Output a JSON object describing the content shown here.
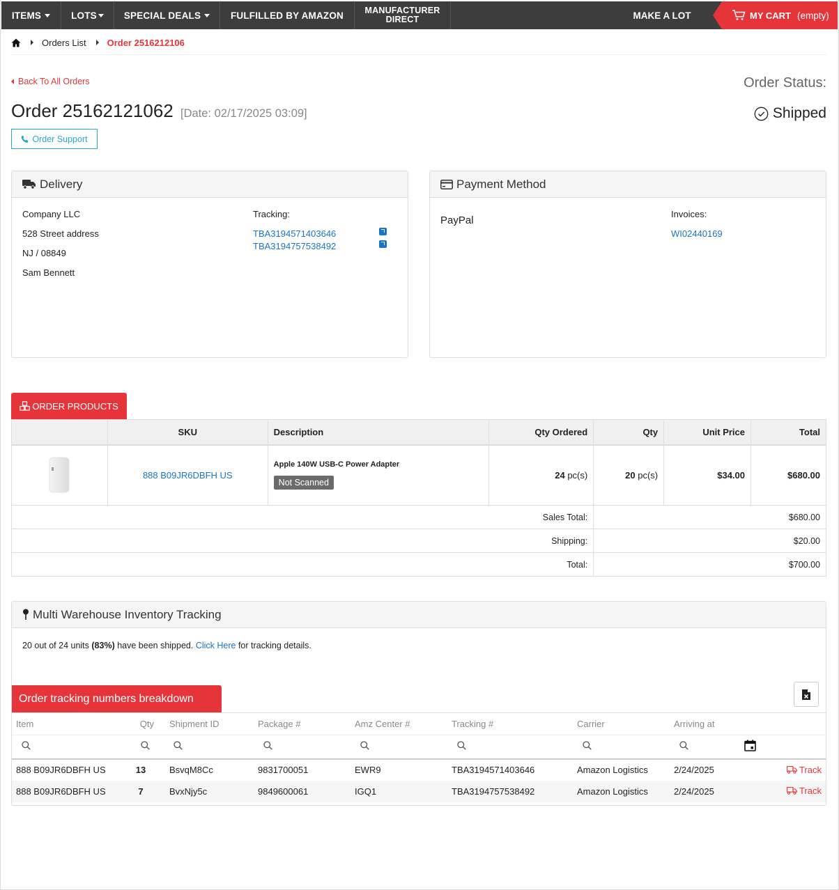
{
  "nav": {
    "items": [
      "ITEMS",
      "LOTS",
      "SPECIAL DEALS",
      "FULFILLED BY AMAZON"
    ],
    "manufacturer_line1": "MANUFACTURER",
    "manufacturer_line2": "DIRECT",
    "make_lot": "MAKE A LOT",
    "cart_label": "MY CART",
    "cart_status": "(empty)"
  },
  "breadcrumb": {
    "orders_list": "Orders List",
    "current": "Order 2516212106"
  },
  "order": {
    "back_link": "Back To All Orders",
    "title": "Order 25162121062",
    "date": "[Date: 02/17/2025 03:09]",
    "support_button": "Order Support",
    "status_label": "Order Status:",
    "status_value": "Shipped"
  },
  "delivery": {
    "title": "Delivery",
    "company": "Company LLC",
    "street": "528 Street address",
    "state_zip": "NJ / 08849",
    "contact": "Sam Bennett",
    "tracking_label": "Tracking:",
    "tracking": [
      "TBA3194571403646",
      "TBA3194757538492"
    ]
  },
  "payment": {
    "title": "Payment Method",
    "method": "PayPal",
    "invoices_label": "Invoices:",
    "invoice": "WI02440169"
  },
  "products": {
    "tab": "ORDER PRODUCTS",
    "headers": {
      "sku": "SKU",
      "description": "Description",
      "qty_ordered": "Qty Ordered",
      "qty": "Qty",
      "unit_price": "Unit Price",
      "total": "Total"
    },
    "rows": [
      {
        "sku": "888 B09JR6DBFH US",
        "description": "Apple 140W USB-C Power Adapter",
        "badge": "Not Scanned",
        "qty_ordered": "24",
        "qty": "20",
        "unit": "pc(s)",
        "unit_price": "$34.00",
        "total": "$680.00"
      }
    ],
    "summary": {
      "sales_total_label": "Sales Total:",
      "sales_total": "$680.00",
      "shipping_label": "Shipping:",
      "shipping": "$20.00",
      "total_label": "Total:",
      "total": "$700.00"
    }
  },
  "warehouse": {
    "title": "Multi Warehouse Inventory Tracking",
    "text_before": "20 out of 24 units ",
    "percent": "(83%)",
    "text_mid": " have been shipped. ",
    "link": "Click Here",
    "text_after": " for tracking details.",
    "breakdown_tab": "Order tracking numbers breakdown",
    "headers": {
      "item": "Item",
      "qty": "Qty",
      "shipment": "Shipment ID",
      "package": "Package #",
      "amz": "Amz Center #",
      "tracking": "Tracking #",
      "carrier": "Carrier",
      "arriving": "Arriving at"
    },
    "rows": [
      {
        "item": "888 B09JR6DBFH US",
        "qty": "13",
        "shipment": "BsvqM8Cc",
        "package": "9831700051",
        "amz": "EWR9",
        "tracking": "TBA3194571403646",
        "carrier": "Amazon Logistics",
        "arriving": "2/24/2025",
        "action": "Track"
      },
      {
        "item": "888 B09JR6DBFH US",
        "qty": "7",
        "shipment": "BvxNjy5c",
        "package": "9849600061",
        "amz": "IGQ1",
        "tracking": "TBA3194757538492",
        "carrier": "Amazon Logistics",
        "arriving": "2/24/2025",
        "action": "Track"
      }
    ]
  }
}
